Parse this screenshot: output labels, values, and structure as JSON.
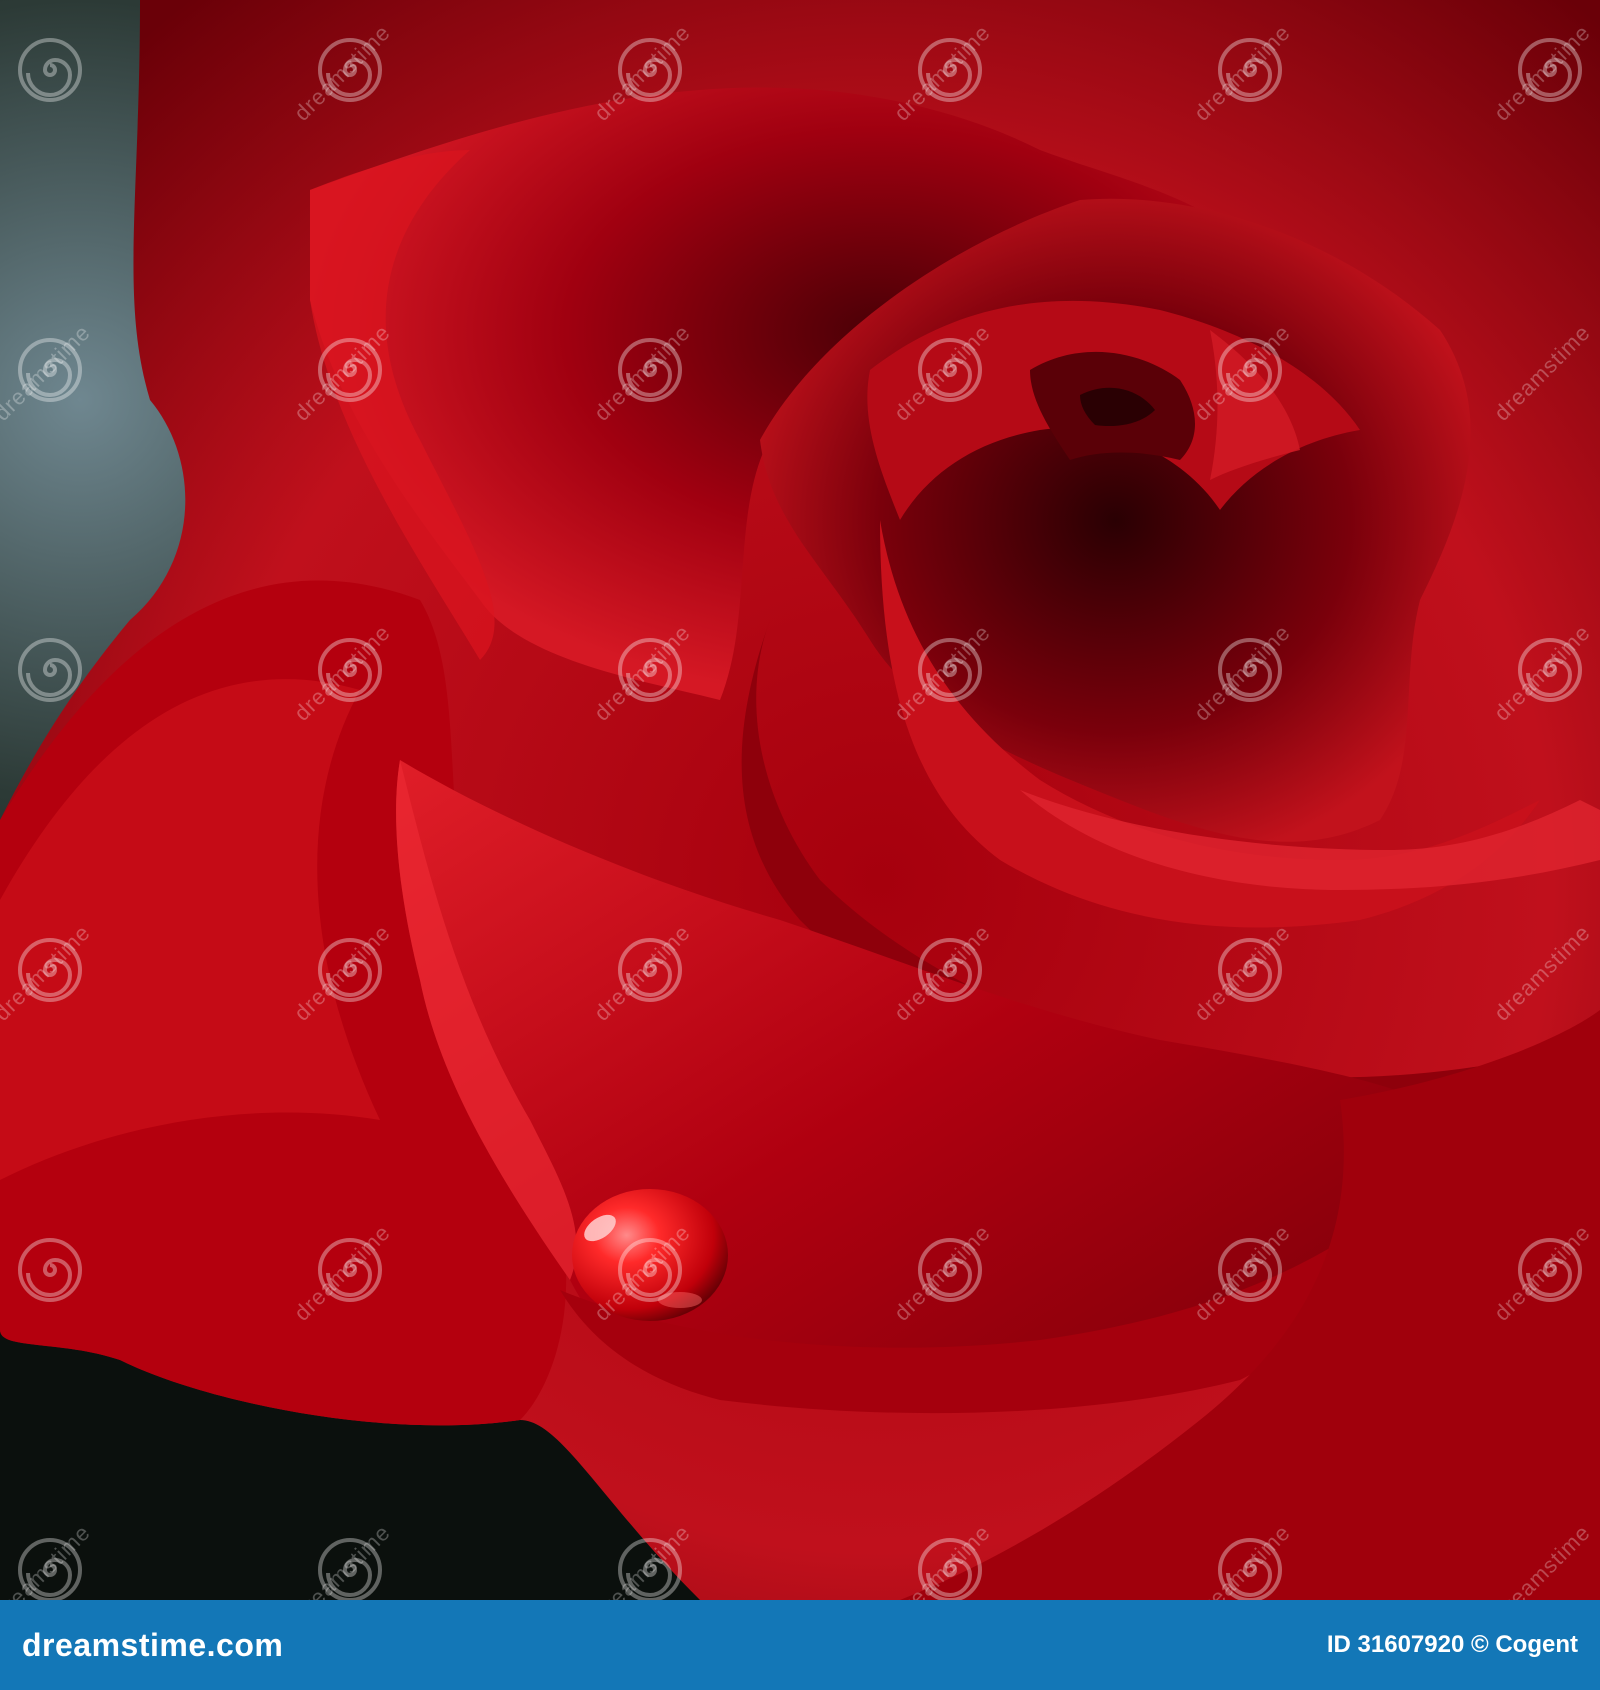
{
  "photo": {
    "subject_icon": "red-rose-photo",
    "water_drop_icon": "water-droplet"
  },
  "watermark": {
    "text": "dreamstime",
    "swirl_icon": "dreamstime-swirl-logo"
  },
  "footer": {
    "site": "dreamstime.com",
    "id_credit": "ID 31607920 © Cogent",
    "background_color": "#1377b7"
  },
  "colors": {
    "rose_primary": "#b00010",
    "rose_highlight": "#e2202b",
    "rose_shadow": "#3e0006",
    "background_dark": "#0c120e",
    "background_blue": "#58707a"
  }
}
